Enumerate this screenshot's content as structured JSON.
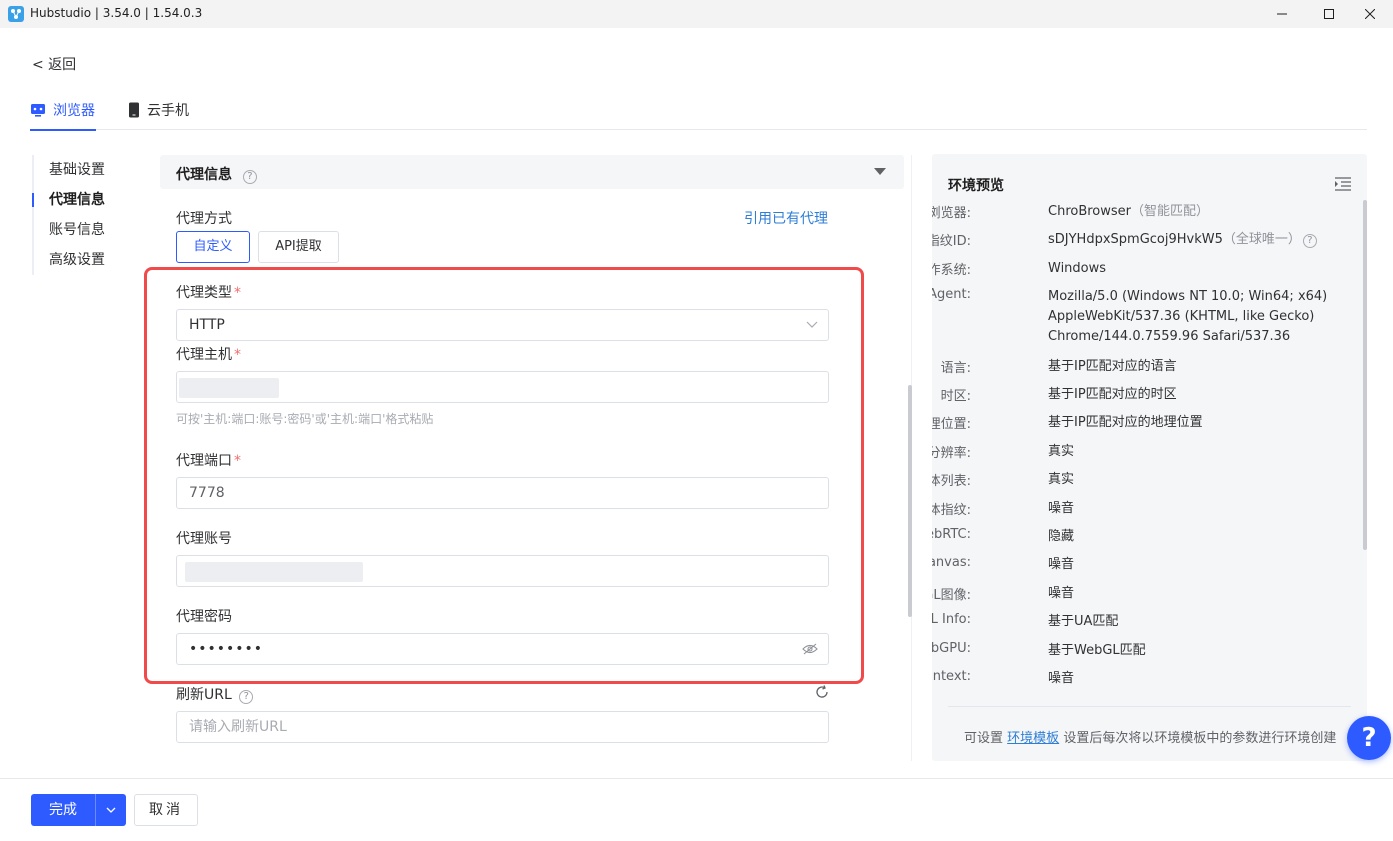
{
  "window": {
    "title": "Hubstudio | 3.54.0 | 1.54.0.3"
  },
  "nav": {
    "back": "< 返回"
  },
  "tabs": [
    {
      "label": "浏览器",
      "icon": "browser-icon"
    },
    {
      "label": "云手机",
      "icon": "phone-icon"
    }
  ],
  "sidenav": [
    "基础设置",
    "代理信息",
    "账号信息",
    "高级设置"
  ],
  "section": {
    "title": "代理信息",
    "help": "?"
  },
  "proxy": {
    "mode_label": "代理方式",
    "use_existing": "引用已有代理",
    "mode_custom": "自定义",
    "mode_api": "API提取",
    "type_label": "代理类型",
    "type_value": "HTTP",
    "host_label": "代理主机",
    "host_hint": "可按'主机:端口:账号:密码'或'主机:端口'格式粘贴",
    "port_label": "代理端口",
    "port_value": "7778",
    "account_label": "代理账号",
    "password_label": "代理密码",
    "password_value": "••••••••",
    "refresh_label": "刷新URL",
    "refresh_placeholder": "请输入刷新URL",
    "required_mark": "*"
  },
  "preview": {
    "title": "环境预览",
    "rows": [
      {
        "key": "浏览器:",
        "value": "ChroBrowser",
        "extra": "（智能匹配）"
      },
      {
        "key": "指纹ID:",
        "value": "sDJYHdpxSpmGcoj9HvkW5",
        "extra": "（全球唯一）"
      },
      {
        "key": "操作系统:",
        "value": "Windows"
      },
      {
        "key": "User Agent:",
        "value": "Mozilla/5.0 (Windows NT 10.0; Win64; x64) AppleWebKit/537.36 (KHTML, like Gecko) Chrome/144.0.7559.96 Safari/537.36"
      },
      {
        "key": "语言:",
        "value": "基于IP匹配对应的语言"
      },
      {
        "key": "时区:",
        "value": "基于IP匹配对应的时区"
      },
      {
        "key": "地理位置:",
        "value": "基于IP匹配对应的地理位置"
      },
      {
        "key": "分辨率:",
        "value": "真实"
      },
      {
        "key": "字体列表:",
        "value": "真实"
      },
      {
        "key": "字体指纹:",
        "value": "噪音"
      },
      {
        "key": "WebRTC:",
        "value": "隐藏"
      },
      {
        "key": "Canvas:",
        "value": "噪音"
      },
      {
        "key": "WebGL图像:",
        "value": "噪音"
      },
      {
        "key": "WebGL Info:",
        "value": "基于UA匹配"
      },
      {
        "key": "WebGPU:",
        "value": "基于WebGL匹配"
      },
      {
        "key": "AudioContext:",
        "value": "噪音"
      }
    ],
    "footer_pre": "可设置",
    "footer_link": "环境模板",
    "footer_post": "设置后每次将以环境模板中的参数进行环境创建"
  },
  "help_fab": "?",
  "footer": {
    "done": "完成",
    "cancel": "取消"
  },
  "colors": {
    "primary": "#2e5bff",
    "highlight": "#f04a4a",
    "link": "#2e7ed6"
  }
}
